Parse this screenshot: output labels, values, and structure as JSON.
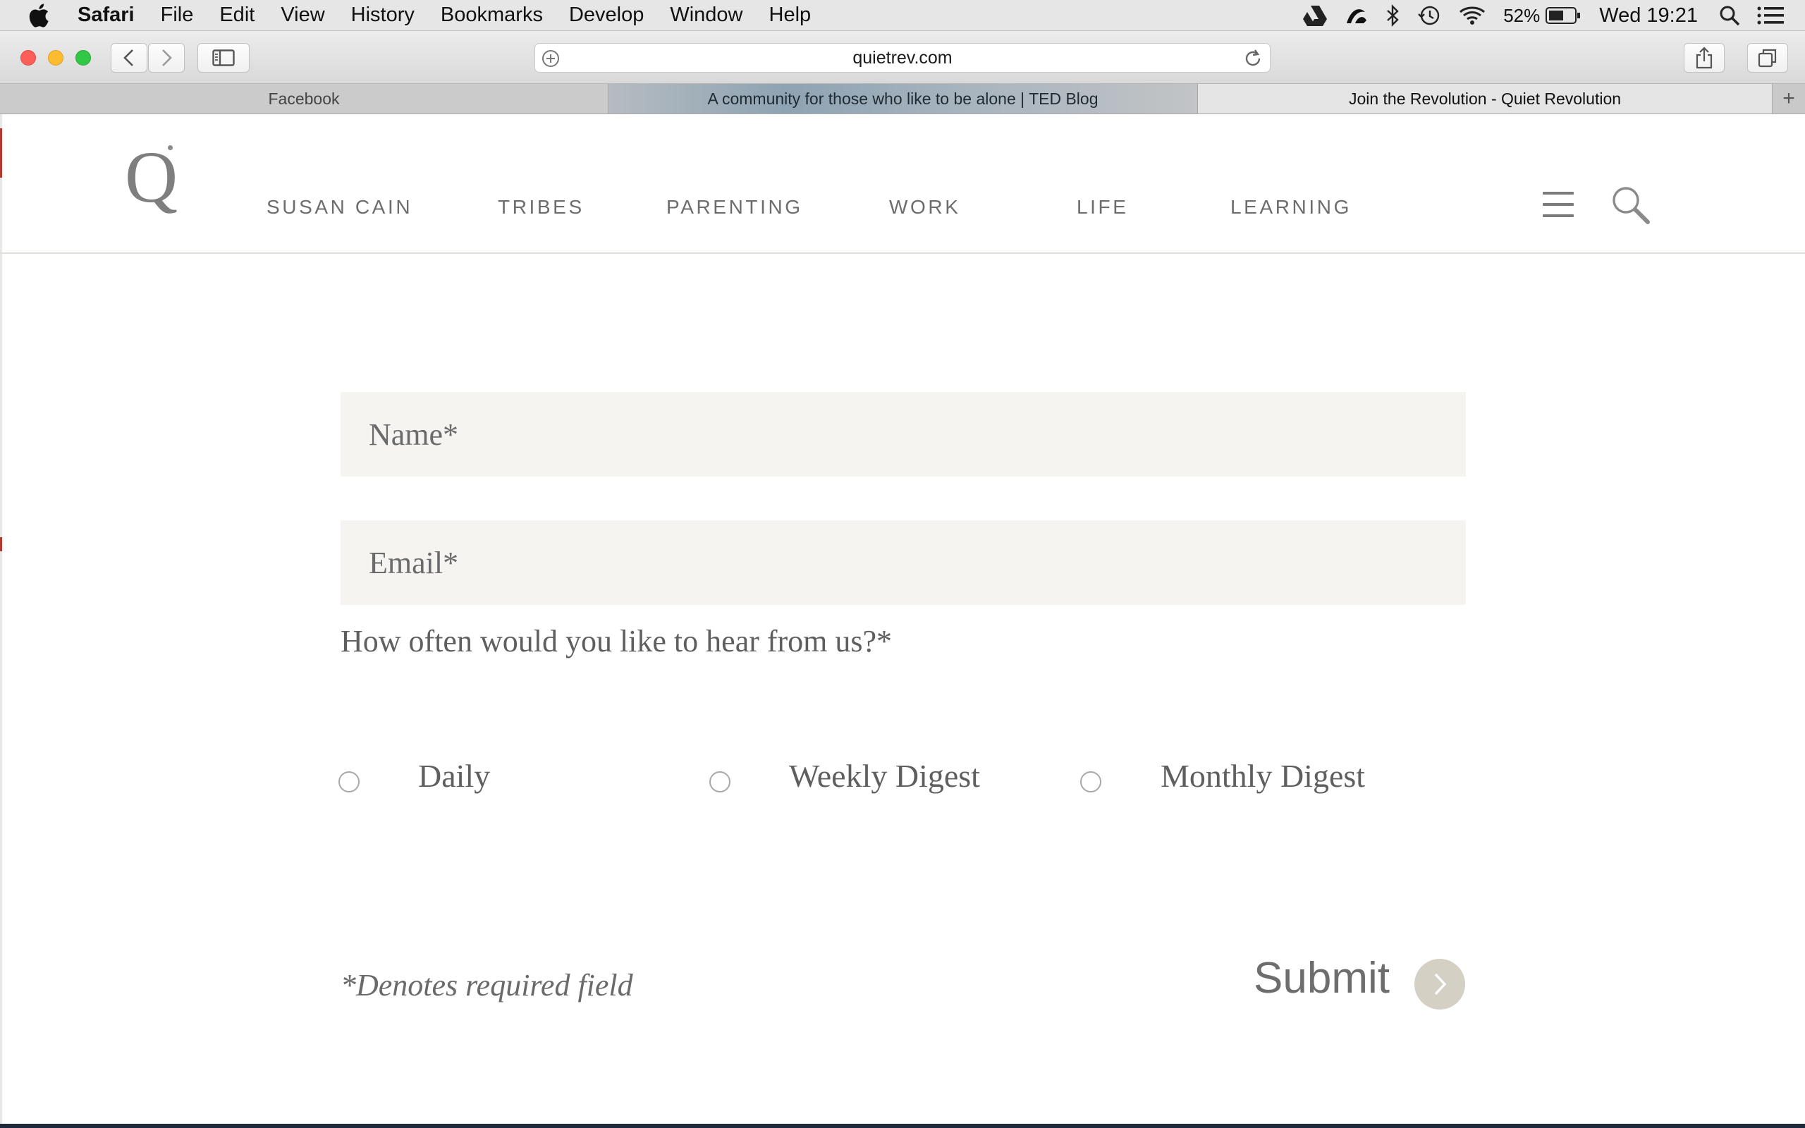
{
  "menubar": {
    "app_name": "Safari",
    "items": [
      "File",
      "Edit",
      "View",
      "History",
      "Bookmarks",
      "Develop",
      "Window",
      "Help"
    ],
    "status": {
      "battery_percent": "52%",
      "clock": "Wed 19:21",
      "icons": [
        "google-drive-icon",
        "creative-cloud-icon",
        "bluetooth-icon",
        "time-machine-icon",
        "wifi-icon",
        "battery-icon",
        "spotlight-icon",
        "notification-center-icon"
      ]
    }
  },
  "browser": {
    "url": "quietrev.com",
    "tabs": [
      {
        "title": "Facebook",
        "active": false
      },
      {
        "title": "A community for those who like to be alone | TED Blog",
        "active": false
      },
      {
        "title": "Join the Revolution - Quiet Revolution",
        "active": true
      }
    ],
    "new_tab_label": "+"
  },
  "site": {
    "logo_text": "Q",
    "nav": [
      "SUSAN CAIN",
      "TRIBES",
      "PARENTING",
      "WORK",
      "LIFE",
      "LEARNING"
    ]
  },
  "form": {
    "name_placeholder": "Name*",
    "email_placeholder": "Email*",
    "frequency_question": "How often would you like to hear from us?*",
    "options": [
      "Daily",
      "Weekly Digest",
      "Monthly Digest"
    ],
    "required_note": "*Denotes required field",
    "submit_label": "Submit"
  },
  "colors": {
    "field_bg": "#f5f4f0",
    "submit_circle": "#d5d0c4",
    "text_gray": "#6b6b6b"
  }
}
